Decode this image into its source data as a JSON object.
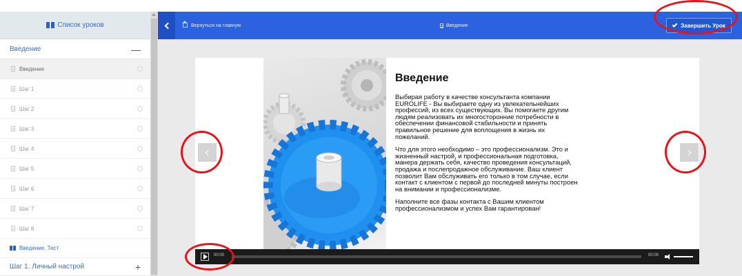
{
  "sidebar": {
    "header_label": "Список уроков",
    "sections": [
      {
        "label": "Введение",
        "sign": "—"
      },
      {
        "label": "Шаг 1. Личный настрой",
        "sign": "+"
      }
    ],
    "lessons": [
      "Введение",
      "Шаг 1",
      "Шаг 2",
      "Шаг 3",
      "Шаг 4",
      "Шаг 5",
      "Шаг 6",
      "Шаг 7",
      "Шаг 8"
    ],
    "test_label": "Введение. Тест"
  },
  "topbar": {
    "home_label": "Вернуться на главную",
    "title": "Введение",
    "finish_label": "Завершить Урок"
  },
  "slide": {
    "title": "Введение",
    "paragraphs": [
      "Выбирая работу в качестве консультанта компании\nEUROLIFE - Вы выбираете одну из увлекательнейших\nпрофессий, из всех существующих. Вы помогаете другим\nлюдям реализовать их многосторонние потребности в\nобеспечении финансовой стабильности и принять\nправильное решение для воплощения в жизнь их\nпожеланий.",
      "Что для этого необходимо – это профессионализм. Это и\nжизненный настрой, и профессиональная подготовка,\nманера держать себя, качество проведения консультаций,\nпродажа и послепродажное обслуживание. Ваш клиент\nпозволит Вам обслуживать его только в том случае, если\nконтакт с клиентом с первой до последней минуты построен\nна внимании и профессионализме.",
      "Наполните все фазы контакта с Вашим клиентом\nпрофессионализмом и успех Вам гарантирован!"
    ]
  },
  "player": {
    "current_time": "00:00",
    "duration": "00:00"
  },
  "colors": {
    "topbar": "#2c62e0",
    "accent_link": "#3a6fc4",
    "annotation": "#e3141b",
    "gear_blue": "#1f8ff0"
  },
  "icons": {
    "sidebar_header": "book-icon",
    "back": "chevron-left-icon",
    "home": "home-icon",
    "title": "document-icon",
    "finish": "checkmark-icon",
    "play": "play-icon",
    "volume": "volume-icon"
  }
}
